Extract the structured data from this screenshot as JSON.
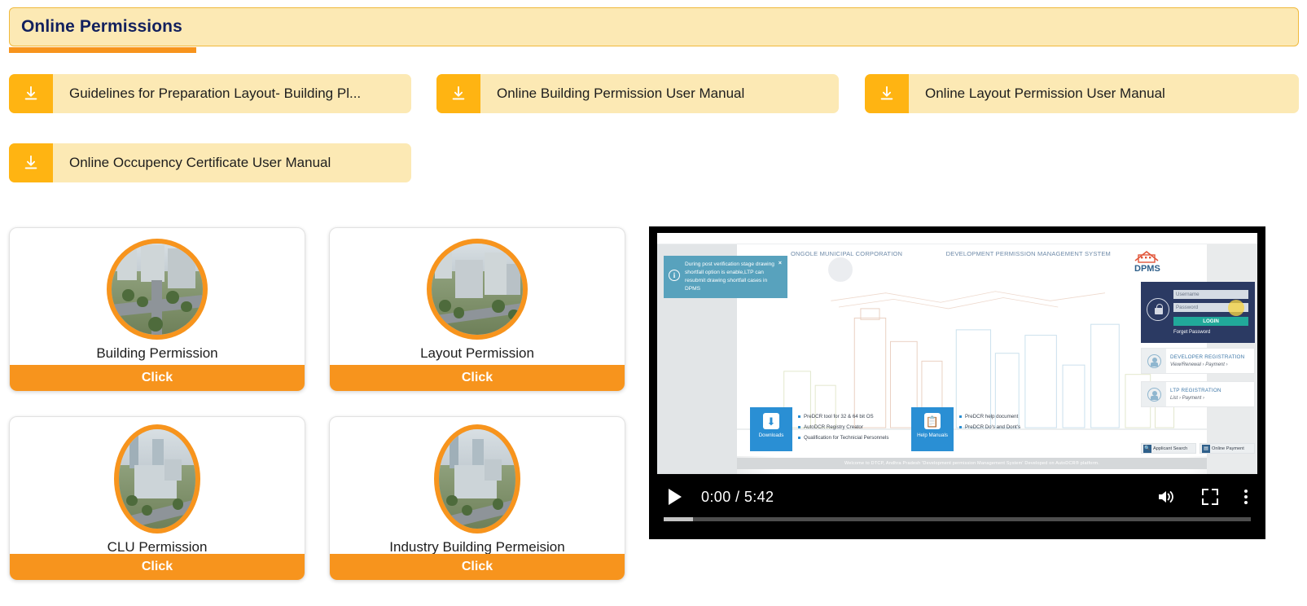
{
  "header": {
    "title": "Online Permissions"
  },
  "downloads": [
    {
      "label": "Guidelines for Preparation Layout- Building Pl...",
      "icon": "download-icon"
    },
    {
      "label": "Online Building Permission User Manual",
      "icon": "download-icon"
    },
    {
      "label": "Online Layout Permission User Manual",
      "icon": "download-icon"
    },
    {
      "label": "Online Occupency Certificate User Manual",
      "icon": "download-icon"
    }
  ],
  "cards": [
    {
      "title": "Building Permission",
      "action": "Click"
    },
    {
      "title": "Layout Permission",
      "action": "Click"
    },
    {
      "title": "CLU Permission",
      "action": "Click"
    },
    {
      "title": "Industry Building Permeision",
      "action": "Click"
    }
  ],
  "video": {
    "current_time": "0:00",
    "duration": "5:42",
    "time_display": "0:00 / 5:42",
    "buffered_percent": 5,
    "progress_percent": 0,
    "controls": {
      "play": "Play",
      "volume": "Mute",
      "fullscreen": "Full screen",
      "more": "More options"
    },
    "content": {
      "tooltip": "During post verification stage drawing shortfall option is enable,LTP can resubmit drawing shortfall cases in DPMS",
      "tooltip_close": "×",
      "tooltip_icon": "i",
      "left_title": "ONGOLE MUNICIPAL CORPORATION",
      "right_title": "DEVELOPMENT PERMISSION MANAGEMENT SYSTEM",
      "logo_text": "DPMS",
      "login": {
        "username_placeholder": "Username",
        "password_placeholder": "Password",
        "login_button": "LOGIN",
        "forget_password": "Forget Password"
      },
      "registrations": [
        {
          "heading": "DEVELOPER REGISTRATION",
          "links": "View/Renewal ›   Payment ›"
        },
        {
          "heading": "LTP REGISTRATION",
          "links": "List ›   Payment ›"
        }
      ],
      "bottom_links": [
        {
          "label": "Applicant Search",
          "icon": "search-icon"
        },
        {
          "label": "Online Payment",
          "icon": "card-icon"
        }
      ],
      "panels": [
        {
          "title": "Downloads",
          "icon": "download-box-icon",
          "items": [
            "PreDCR tool for 32 & 64 bit OS",
            "AutoDCR Registry Creator",
            "Qualification for Technicial Personnels"
          ]
        },
        {
          "title": "Help Manuals",
          "icon": "clipboard-icon",
          "items": [
            "PreDCR help document",
            "PreDCR Do's and Dont's"
          ]
        }
      ],
      "footer": "Welcome to DTCP, Andhra Pradesh 'Development permission Management System' Developed on AutoDCR® platform."
    }
  },
  "colors": {
    "banner_bg": "#fce9b4",
    "banner_border": "#f0ba3e",
    "banner_text": "#12205e",
    "accent_orange": "#f7941d",
    "icon_orange": "#ffb412",
    "card_bg": "#ffffff",
    "video_bg": "#000000",
    "tooltip_bg": "#58a2bd",
    "login_bg": "#2b3a63",
    "login_btn": "#21a99a",
    "panel_blue": "#2a8fd4"
  }
}
